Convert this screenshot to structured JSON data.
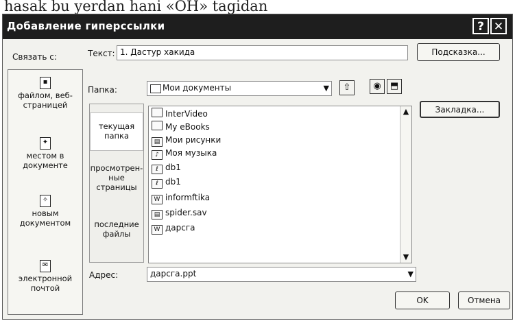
{
  "background_text": "hasak bu yerdan hani «OH» tagidan",
  "dialog": {
    "title": "Добавление гиперссылки",
    "help_glyph": "?",
    "close_glyph": "✕"
  },
  "link_with_label": "Связать с:",
  "text_label": "Текст:",
  "text_value": "1. Дастур хакида",
  "tooltip_button": "Подсказка...",
  "folder_label": "Папка:",
  "folder_value": "Мои документы",
  "bookmark_button": "Закладка...",
  "left_items": [
    {
      "label": "файлом, веб-\nстраницей",
      "icon": "file-icon"
    },
    {
      "label": "местом в\nдокументе",
      "icon": "place-icon"
    },
    {
      "label": "новым\nдокументом",
      "icon": "new-doc-icon"
    },
    {
      "label": "электронной\nпочтой",
      "icon": "mail-icon"
    }
  ],
  "nav_items": [
    {
      "label": "текущая\nпапка"
    },
    {
      "label": "просмотрен-\nные\nстраницы"
    },
    {
      "label": "последние\nфайлы"
    }
  ],
  "files": [
    {
      "name": "InterVideo",
      "icon": "folder-icon"
    },
    {
      "name": "My eBooks",
      "icon": "folder-icon"
    },
    {
      "name": "Мои рисунки",
      "icon": "pictures-folder-icon"
    },
    {
      "name": "Моя музыка",
      "icon": "music-folder-icon"
    },
    {
      "name": "db1",
      "icon": "access-file-icon"
    },
    {
      "name": "db1",
      "icon": "access-file-icon"
    },
    {
      "name": "informftika",
      "icon": "word-file-icon"
    },
    {
      "name": "spider.sav",
      "icon": "file-icon"
    },
    {
      "name": "дарсга",
      "icon": "word-file-icon"
    }
  ],
  "address_label": "Адрес:",
  "address_value": "дарсга.ppt",
  "ok_button": "OK",
  "cancel_button": "Отмена"
}
